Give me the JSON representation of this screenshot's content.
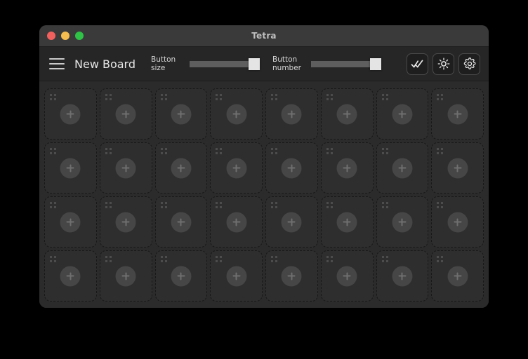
{
  "window": {
    "title": "Tetra",
    "controls": [
      {
        "name": "close",
        "color": "#f0615e"
      },
      {
        "name": "minimize",
        "color": "#f5bd4f"
      },
      {
        "name": "maximize",
        "color": "#2fc246"
      }
    ]
  },
  "toolbar": {
    "menu_icon": "hamburger-icon",
    "board_name": "New Board",
    "sliders": [
      {
        "label": "Button\nsize",
        "label_line1": "Button",
        "label_line2": "size",
        "value": 100,
        "min": 0,
        "max": 100
      },
      {
        "label": "Button\nnumber",
        "label_line1": "Button",
        "label_line2": "number",
        "value": 100,
        "min": 0,
        "max": 100
      }
    ],
    "actions": [
      {
        "name": "confirm-all-button",
        "icon": "double-check-icon"
      },
      {
        "name": "brightness-button",
        "icon": "sun-icon"
      },
      {
        "name": "settings-button",
        "icon": "gear-icon"
      }
    ]
  },
  "board": {
    "columns": 8,
    "rows": 4,
    "cell_count": 32,
    "cell": {
      "grip_icon": "grip-dots-icon",
      "add_icon": "plus-icon"
    }
  },
  "colors": {
    "desktop_background": "#000000",
    "window_background": "#2b2b2b",
    "titlebar_background": "#3a3a3a",
    "toolbar_background": "#262626",
    "cell_background": "#2e2e2e",
    "cell_border": "#181818",
    "slider_track": "#5e5e5e",
    "slider_thumb": "#e4e4e4",
    "text_primary": "#e6e6e6",
    "text_secondary": "#d5d5d5",
    "title_text": "#bfbfbf"
  }
}
